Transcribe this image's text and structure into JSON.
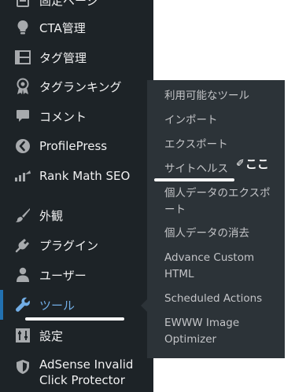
{
  "sidebar": {
    "items": [
      {
        "label": "固定ページ",
        "icon": "page-icon"
      },
      {
        "label": "CTA管理",
        "icon": "lightbulb-icon"
      },
      {
        "label": "タグ管理",
        "icon": "film-icon"
      },
      {
        "label": "タグランキング",
        "icon": "award-icon"
      },
      {
        "label": "コメント",
        "icon": "comment-icon"
      },
      {
        "label": "ProfilePress",
        "icon": "profilepress-icon"
      },
      {
        "label": "Rank Math SEO",
        "icon": "chart-icon"
      },
      {
        "label": "外観",
        "icon": "brush-icon"
      },
      {
        "label": "プラグイン",
        "icon": "plugin-icon"
      },
      {
        "label": "ユーザー",
        "icon": "user-icon"
      },
      {
        "label": "ツール",
        "icon": "wrench-icon",
        "active": true
      },
      {
        "label": "設定",
        "icon": "settings-icon"
      },
      {
        "label": "AdSense Invalid Click Protector",
        "icon": "shield-icon"
      }
    ],
    "adsense_line1": "AdSense Invalid",
    "adsense_line2": "Click Protector"
  },
  "submenu": {
    "items": [
      "利用可能なツール",
      "インポート",
      "エクスポート",
      "サイトヘルス",
      "個人データのエクスポート",
      "個人データの消去",
      "Advance Custom HTML",
      "Scheduled Actions",
      "EWWW Image Optimizer"
    ],
    "export_line1": "個人データのエクスポ",
    "export_line2": "ート",
    "ach_line1": "Advance Custom",
    "ach_line2": "HTML",
    "ewww_line1": "EWWW Image",
    "ewww_line2": "Optimizer"
  },
  "annotation": {
    "text": "ここ",
    "pen": "✐"
  },
  "colors": {
    "sidebar_bg": "#1d2327",
    "submenu_bg": "#2c3338",
    "active_text": "#72aee6",
    "active_bar": "#2271b1",
    "menu_text": "#f0f0f1",
    "submenu_text": "#c3c4c7"
  }
}
